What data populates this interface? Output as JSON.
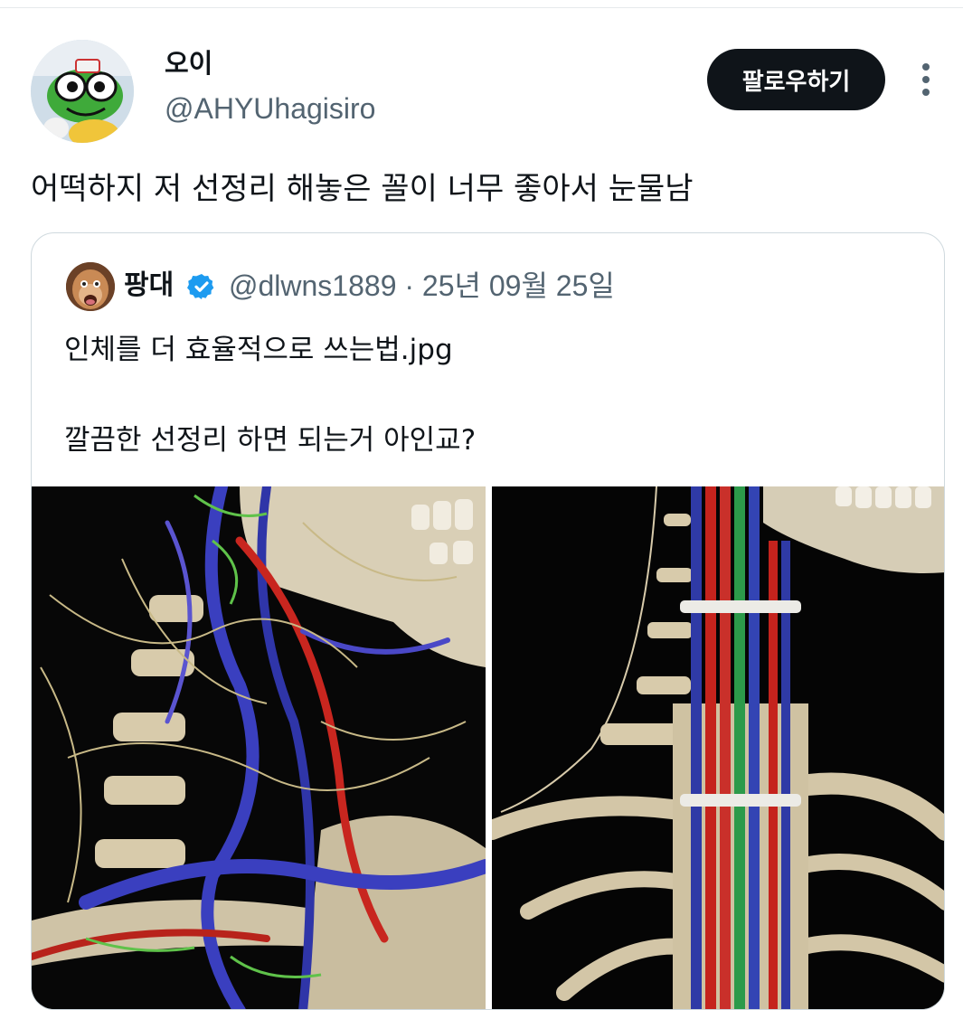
{
  "author": {
    "display_name": "오이",
    "handle": "@AHYUhagisiro",
    "avatar_icon": "keroro-avatar"
  },
  "actions": {
    "follow_label": "팔로우하기",
    "more_icon": "more-vertical-icon"
  },
  "tweet": {
    "text": "어떡하지 저 선정리 해놓은 꼴이 너무 좋아서 눈물남"
  },
  "quoted": {
    "display_name": "팡대",
    "verified_icon": "verified-badge-icon",
    "meta": "@dlwns1889 · 25년 09월 25일",
    "text_line1": "인체를 더 효율적으로 쓰는법.jpg",
    "text_line2": "깔끔한 선정리 하면 되는거 아인교?",
    "images": [
      "tangled-nerves-vessels-image",
      "organized-cable-spine-image"
    ]
  },
  "colors": {
    "text_primary": "#0f1419",
    "text_secondary": "#536471",
    "border": "#cfd9de",
    "follow_bg": "#0f1419",
    "verified": "#1d9bf0"
  }
}
